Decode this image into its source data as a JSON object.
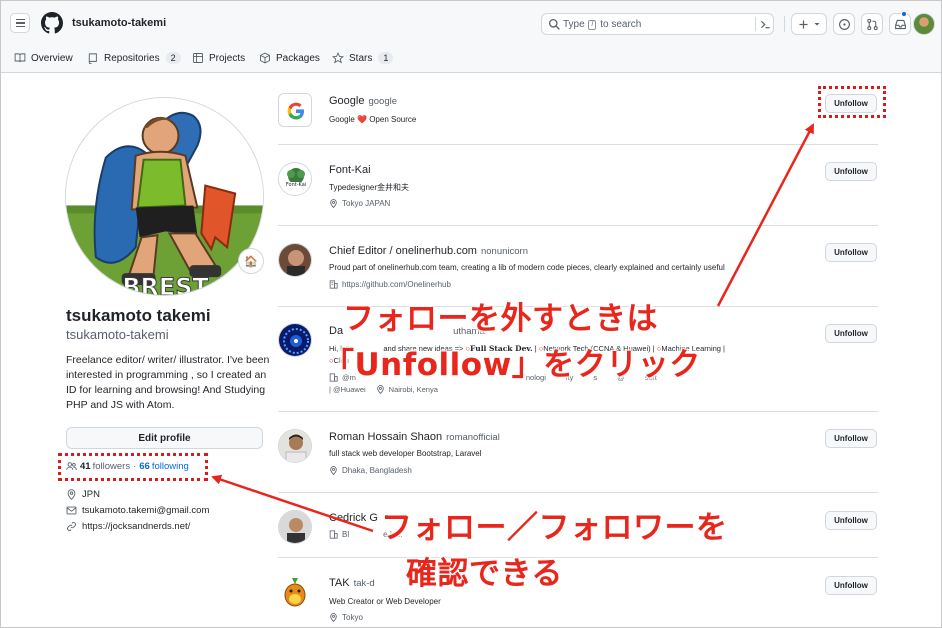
{
  "header": {
    "username": "tsukamoto-takemi",
    "search_prefix": "Type",
    "search_key": "/",
    "search_suffix": "to search",
    "tabs": [
      {
        "label": "Overview",
        "count": ""
      },
      {
        "label": "Repositories",
        "count": "2"
      },
      {
        "label": "Projects",
        "count": ""
      },
      {
        "label": "Packages",
        "count": ""
      },
      {
        "label": "Stars",
        "count": "1"
      }
    ]
  },
  "profile": {
    "full_name": "tsukamoto takemi",
    "login": "tsukamoto-takemi",
    "bio": "Freelance editor/ writer/ illustrator. I've been interested in programming , so I created an ID for learning and browsing! And Studying PHP and JS with Atom.",
    "edit_label": "Edit profile",
    "followers_count": "41",
    "followers_label": "followers",
    "separator": "·",
    "following_count": "66",
    "following_label": "following",
    "location": "JPN",
    "email": "tsukamoto.takemi@gmail.com",
    "website": "https://jocksandnerds.net/",
    "status_emoji": "🏠"
  },
  "following": [
    {
      "name": "Google",
      "login": "google",
      "bio": "Google ❤️ Open Source",
      "meta": [],
      "button": "Unfollow"
    },
    {
      "name": "Font-Kai",
      "login": "",
      "bio": "Typedesigner金井和夫",
      "meta": [
        "Tokyo JAPAN"
      ],
      "button": "Unfollow"
    },
    {
      "name": "Chief Editor / onelinerhub.com",
      "login": "nonunicorn",
      "bio": "Proud part of onelinerhub.com team, creating a lib of modern code pieces, clearly explained and certainly useful",
      "meta": [
        "https://github.com/Onelinerhub"
      ],
      "button": "Unfollow"
    },
    {
      "name": "Da",
      "login": "uthama",
      "bio_a": "Hi, let's",
      "bio_b": "and share new ideas =>",
      "bio_c": "Full Stack Dev.",
      "bio_d": "Network Tech.(CCNA & Huawei)",
      "bio_e": "Machine Learning |",
      "line2_a": "Clou",
      "line3_a": "@m",
      "line3_b": "nologi",
      "line3_c": "ity",
      "line3_d": "s",
      "line3_e": "@",
      "line3_f": "soft",
      "line4_a": "| @Huawei",
      "line4_b": "Nairobi, Kenya",
      "button": "Unfollow"
    },
    {
      "name": "Roman Hossain Shaon",
      "login": "romanofficial",
      "bio": "full stack web developer Bootstrap, Laravel",
      "meta": [
        "Dhaka, Bangladesh"
      ],
      "button": "Unfollow"
    },
    {
      "name": "Cedrick G",
      "login": "",
      "bio_a": "Bl",
      "bio_b": "e Inc.",
      "button": "Unfollow"
    },
    {
      "name": "TAK",
      "login": "tak-d",
      "bio": "Web Creator or Web Developer",
      "meta": [
        "Tokyo"
      ],
      "button": "Unfollow"
    }
  ],
  "annotations": {
    "unfollow_line1": "フォローを外すときは",
    "unfollow_line2": "「Unfollow」をクリック",
    "follow_line1": "フォロー／フォロワーを",
    "follow_line2": "確認できる",
    "color": "#e8261c"
  }
}
